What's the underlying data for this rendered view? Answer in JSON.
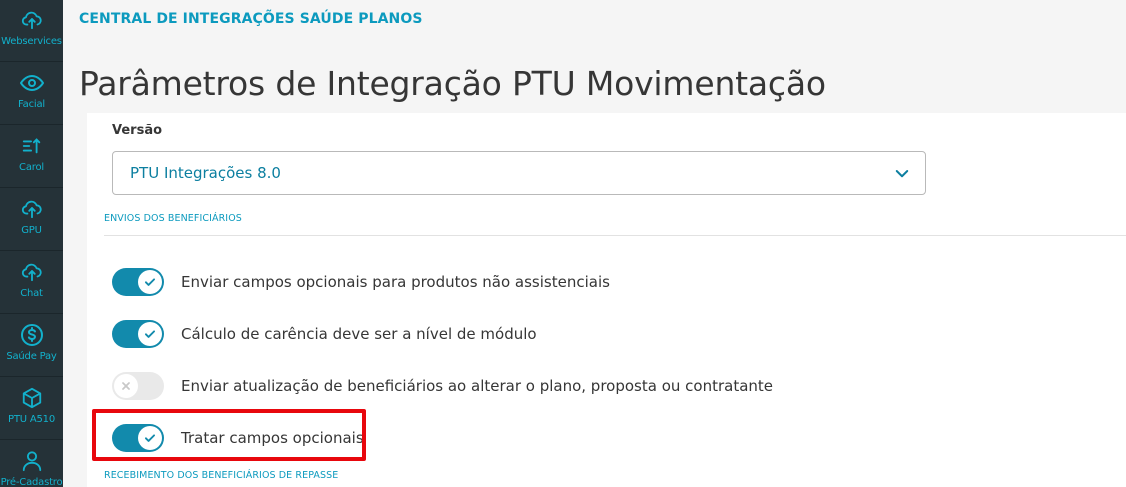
{
  "sidebar": {
    "items": [
      {
        "label": "Webservices",
        "icon": "cloud-sync-icon"
      },
      {
        "label": "Facial",
        "icon": "eye-icon"
      },
      {
        "label": "Carol",
        "icon": "sort-up-icon"
      },
      {
        "label": "GPU",
        "icon": "cloud-upload-icon"
      },
      {
        "label": "Chat",
        "icon": "cloud-upload-icon"
      },
      {
        "label": "Saúde Pay",
        "icon": "dollar-circle-icon"
      },
      {
        "label": "PTU A510",
        "icon": "box-icon"
      },
      {
        "label": "Pré-Cadastro",
        "icon": "person-icon"
      }
    ]
  },
  "header": {
    "breadcrumb": "CENTRAL DE INTEGRAÇÕES SAÚDE PLANOS",
    "title": "Parâmetros de Integração PTU Movimentação"
  },
  "form": {
    "version_label": "Versão",
    "version_value": "PTU Integrações 8.0",
    "section_envios": "ENVIOS DOS BENEFICIÁRIOS",
    "section_recebimento": "RECEBIMENTO DOS BENEFICIÁRIOS DE REPASSE",
    "toggles": [
      {
        "label": "Enviar campos opcionais para produtos não assistenciais",
        "checked": true
      },
      {
        "label": "Cálculo de carência deve ser a nível de módulo",
        "checked": true
      },
      {
        "label": "Enviar atualização de beneficiários ao alterar o plano, proposta ou contratante",
        "checked": false
      },
      {
        "label": "Tratar campos opcionais",
        "checked": true
      }
    ]
  },
  "colors": {
    "sidebar_bg": "#253238",
    "accent": "#0c9abe",
    "toggle_on": "#128aac",
    "toggle_off": "#e9e9e9",
    "highlight": "#e8070d"
  }
}
